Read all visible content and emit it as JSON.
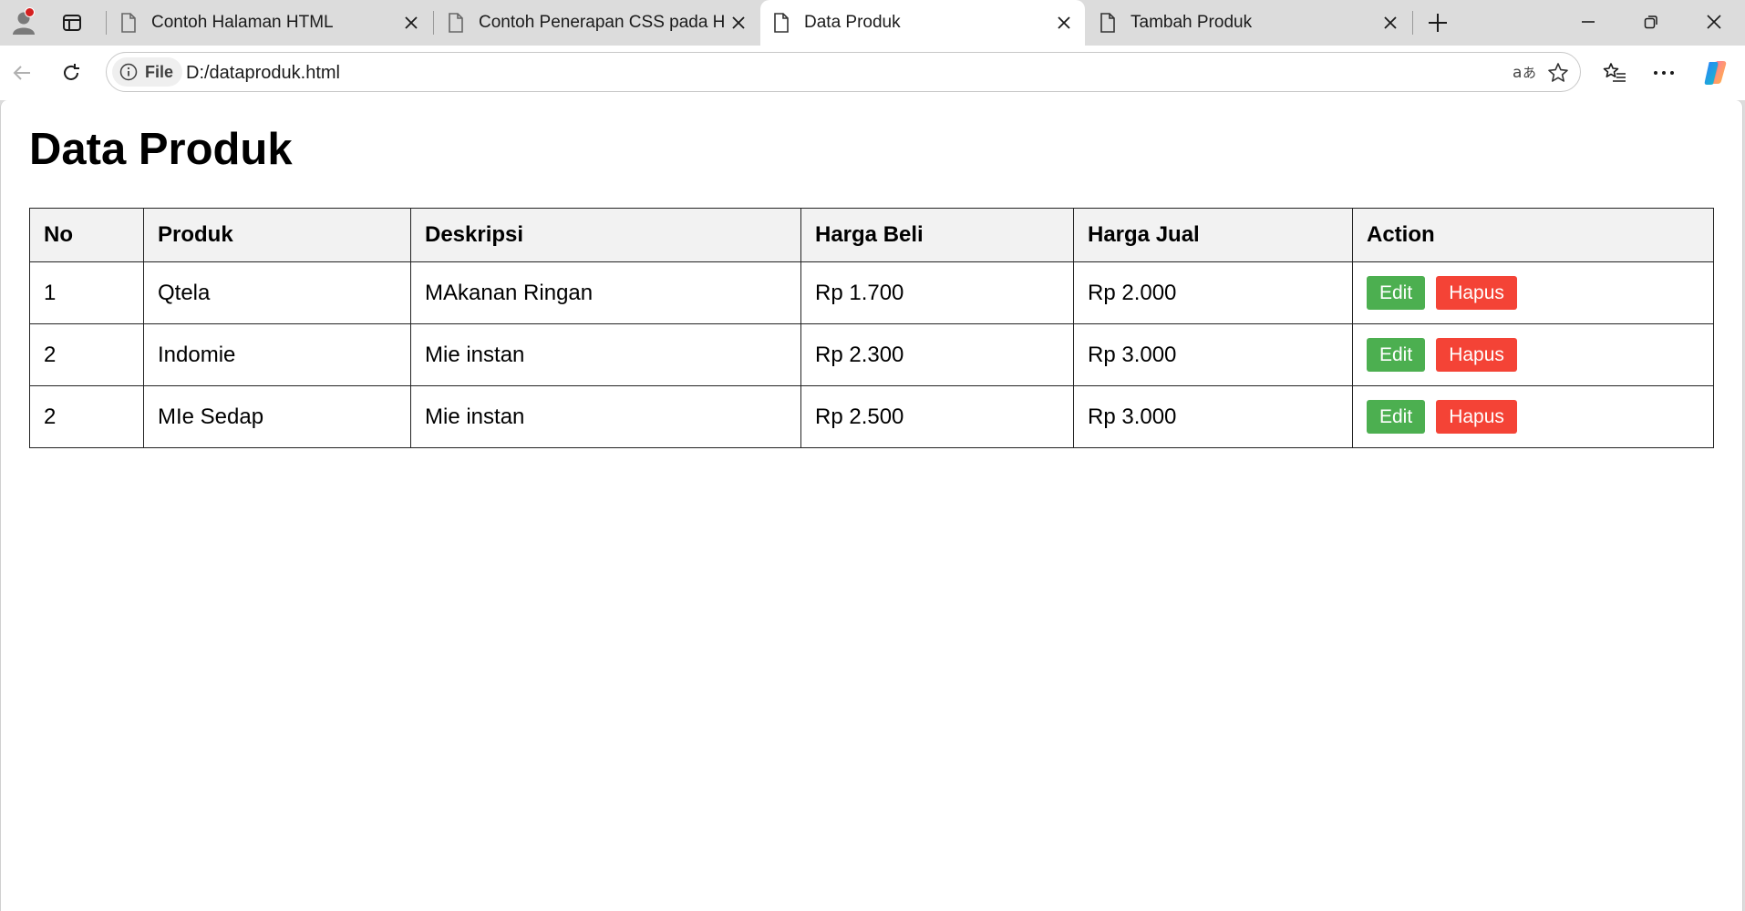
{
  "browser": {
    "tabs": [
      {
        "title": "Contoh Halaman HTML",
        "active": false
      },
      {
        "title": "Contoh Penerapan CSS pada HTM",
        "active": false
      },
      {
        "title": "Data Produk",
        "active": true
      },
      {
        "title": "Tambah Produk",
        "active": false
      }
    ],
    "site_info_label": "File",
    "url": "D:/dataproduk.html",
    "colors": {
      "profile_badge": "#d42020"
    }
  },
  "page": {
    "title": "Data Produk",
    "table": {
      "headers": [
        "No",
        "Produk",
        "Deskripsi",
        "Harga Beli",
        "Harga Jual",
        "Action"
      ],
      "rows": [
        {
          "no": "1",
          "produk": "Qtela",
          "deskripsi": "MAkanan Ringan",
          "harga_beli": "Rp 1.700",
          "harga_jual": "Rp 2.000"
        },
        {
          "no": "2",
          "produk": "Indomie",
          "deskripsi": "Mie instan",
          "harga_beli": "Rp 2.300",
          "harga_jual": "Rp 3.000"
        },
        {
          "no": "2",
          "produk": "MIe Sedap",
          "deskripsi": "Mie instan",
          "harga_beli": "Rp 2.500",
          "harga_jual": "Rp 3.000"
        }
      ]
    },
    "actions": {
      "edit_label": "Edit",
      "delete_label": "Hapus"
    },
    "colors": {
      "edit_button": "#4caf50",
      "delete_button": "#f44336",
      "header_bg": "#f2f2f2"
    }
  }
}
